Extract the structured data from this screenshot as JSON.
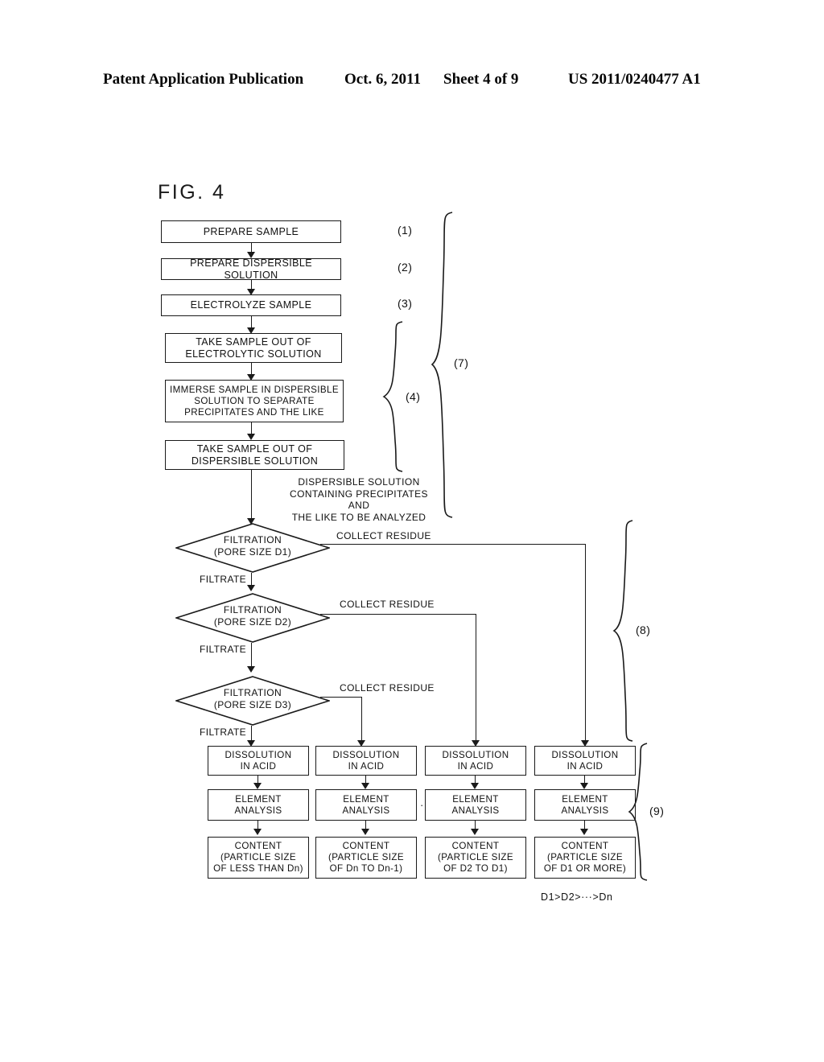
{
  "header": {
    "publication": "Patent Application Publication",
    "date": "Oct. 6, 2011",
    "sheet": "Sheet 4 of 9",
    "patent_number": "US 2011/0240477 A1"
  },
  "figure": {
    "title": "FIG. 4",
    "type": "flowchart",
    "steps": [
      {
        "id": "s1",
        "label": "PREPARE SAMPLE",
        "ref": "(1)"
      },
      {
        "id": "s2",
        "label": "PREPARE DISPERSIBLE SOLUTION",
        "ref": "(2)"
      },
      {
        "id": "s3",
        "label": "ELECTROLYZE SAMPLE",
        "ref": "(3)"
      },
      {
        "id": "s4",
        "label": "TAKE SAMPLE OUT OF\nELECTROLYTIC SOLUTION",
        "ref": ""
      },
      {
        "id": "s5",
        "label": "IMMERSE SAMPLE IN DISPERSIBLE\nSOLUTION TO SEPARATE\nPRECIPITATES AND THE LIKE",
        "ref": ""
      },
      {
        "id": "s6",
        "label": "TAKE SAMPLE OUT OF\nDISPERSIBLE SOLUTION",
        "ref": ""
      }
    ],
    "annotations": {
      "dispersible_note": "DISPERSIBLE SOLUTION\nCONTAINING PRECIPITATES AND\nTHE LIKE TO BE ANALYZED",
      "formula": "D1>D2>···>Dn",
      "ellipsis": "·····"
    },
    "filtrations": [
      {
        "id": "f1",
        "label": "FILTRATION\n(PORE SIZE D1)",
        "residue_label": "COLLECT RESIDUE",
        "filtrate_label": "FILTRATE"
      },
      {
        "id": "f2",
        "label": "FILTRATION\n(PORE SIZE D2)",
        "residue_label": "COLLECT RESIDUE",
        "filtrate_label": "FILTRATE"
      },
      {
        "id": "f3",
        "label": "FILTRATION\n(PORE SIZE D3)",
        "residue_label": "COLLECT RESIDUE",
        "filtrate_label": "FILTRATE"
      }
    ],
    "analysis_columns": [
      {
        "dissolution": "DISSOLUTION\nIN ACID",
        "element_analysis": "ELEMENT\nANALYSIS",
        "content": "CONTENT\n(PARTICLE SIZE\nOF LESS THAN Dn)"
      },
      {
        "dissolution": "DISSOLUTION\nIN ACID",
        "element_analysis": "ELEMENT\nANALYSIS",
        "content": "CONTENT\n(PARTICLE SIZE\nOF Dn TO Dn-1)"
      },
      {
        "dissolution": "DISSOLUTION\nIN ACID",
        "element_analysis": "ELEMENT\nANALYSIS",
        "content": "CONTENT\n(PARTICLE SIZE\nOF D2 TO D1)"
      },
      {
        "dissolution": "DISSOLUTION\nIN ACID",
        "element_analysis": "ELEMENT\nANALYSIS",
        "content": "CONTENT\n(PARTICLE SIZE\nOF D1 OR MORE)"
      }
    ],
    "group_refs": {
      "g4": "(4)",
      "g7": "(7)",
      "g8": "(8)",
      "g9": "(9)"
    },
    "colors": {
      "ink": "#1a1a1a",
      "paper": "#ffffff"
    }
  }
}
